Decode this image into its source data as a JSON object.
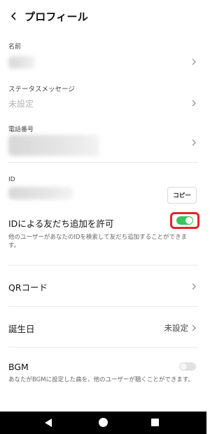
{
  "header": {
    "title": "プロフィール"
  },
  "name_section": {
    "label": "名前"
  },
  "status_section": {
    "label": "ステータスメッセージ",
    "value": "未設定"
  },
  "phone_section": {
    "label": "電話番号"
  },
  "id_section": {
    "label": "ID",
    "copy_label": "コピー"
  },
  "id_search": {
    "title": "IDによる友だち追加を許可",
    "description": "他のユーザーがあなたのIDを検索して友だち追加することができます。",
    "enabled": true,
    "toggle_color": "#3bc15f",
    "highlight_color": "#e8222a"
  },
  "qr": {
    "title": "QRコード"
  },
  "birthday": {
    "title": "誕生日",
    "value": "未設定"
  },
  "bgm": {
    "title": "BGM",
    "description": "あなたがBGMに設定した曲を、他のユーザーが聴くことができます。",
    "enabled": false
  }
}
